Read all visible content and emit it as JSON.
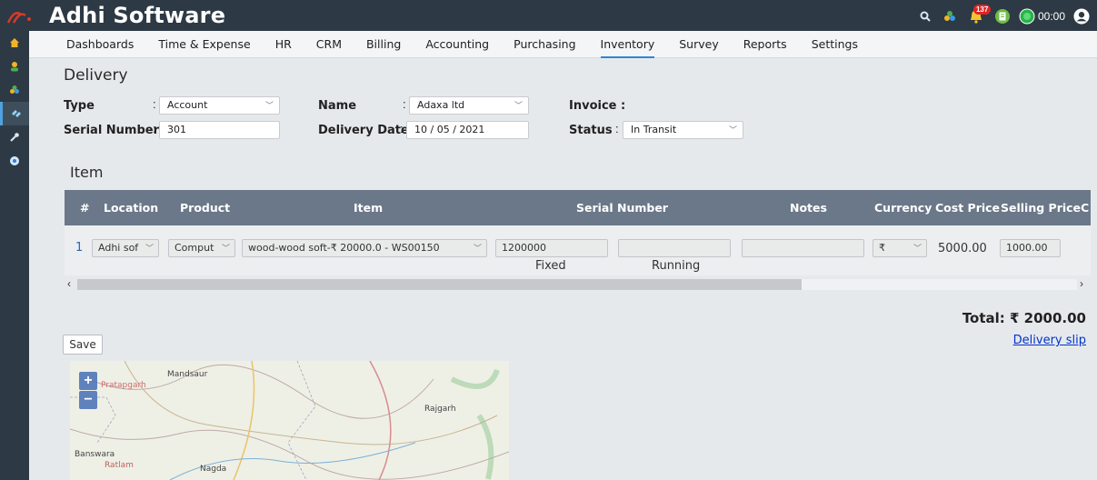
{
  "app": {
    "title": "Adhi Software",
    "notification_count": "137",
    "timer": "00:00"
  },
  "nav": {
    "items": [
      {
        "label": "Dashboards"
      },
      {
        "label": "Time & Expense"
      },
      {
        "label": "HR"
      },
      {
        "label": "CRM"
      },
      {
        "label": "Billing"
      },
      {
        "label": "Accounting"
      },
      {
        "label": "Purchasing"
      },
      {
        "label": "Inventory"
      },
      {
        "label": "Survey"
      },
      {
        "label": "Reports"
      },
      {
        "label": "Settings"
      }
    ],
    "active": "Inventory"
  },
  "page": {
    "title": "Delivery",
    "form": {
      "type_label": "Type",
      "type_value": "Account",
      "name_label": "Name",
      "name_value": "Adaxa ltd",
      "invoice_label": "Invoice :",
      "serial_label": "Serial Number",
      "serial_value": "301",
      "date_label": "Delivery Date",
      "date_value": "10 / 05 / 2021",
      "status_label": "Status",
      "status_value": "In Transit"
    },
    "item_section": "Item",
    "table": {
      "headers": [
        "#",
        "Location",
        "Product",
        "Item",
        "Serial Number",
        "Notes",
        "Currency",
        "Cost Price",
        "Selling Price",
        "C"
      ],
      "row": {
        "num": "1",
        "location": "Adhi sof",
        "product": "Comput",
        "item": "wood-wood soft-₹ 20000.0 - WS00150",
        "serial_fixed": "1200000",
        "serial_running": "",
        "notes": "",
        "currency": "₹",
        "cost_price": "5000.00",
        "selling_price": "1000.00",
        "fixed_label": "Fixed",
        "running_label": "Running"
      }
    },
    "total": "Total: ₹ 2000.00",
    "delivery_slip": "Delivery slip",
    "save": "Save"
  },
  "map": {
    "zoom_in": "+",
    "zoom_out": "−",
    "cities": [
      "Mandsaur",
      "Pratapgarh",
      "Rajgarh",
      "Banswara",
      "Ratlam",
      "Nagda"
    ]
  },
  "colors": {
    "header_bg": "#2d3944",
    "table_header_bg": "#6a7889",
    "accent": "#2b88d8",
    "link": "#0033cc"
  }
}
